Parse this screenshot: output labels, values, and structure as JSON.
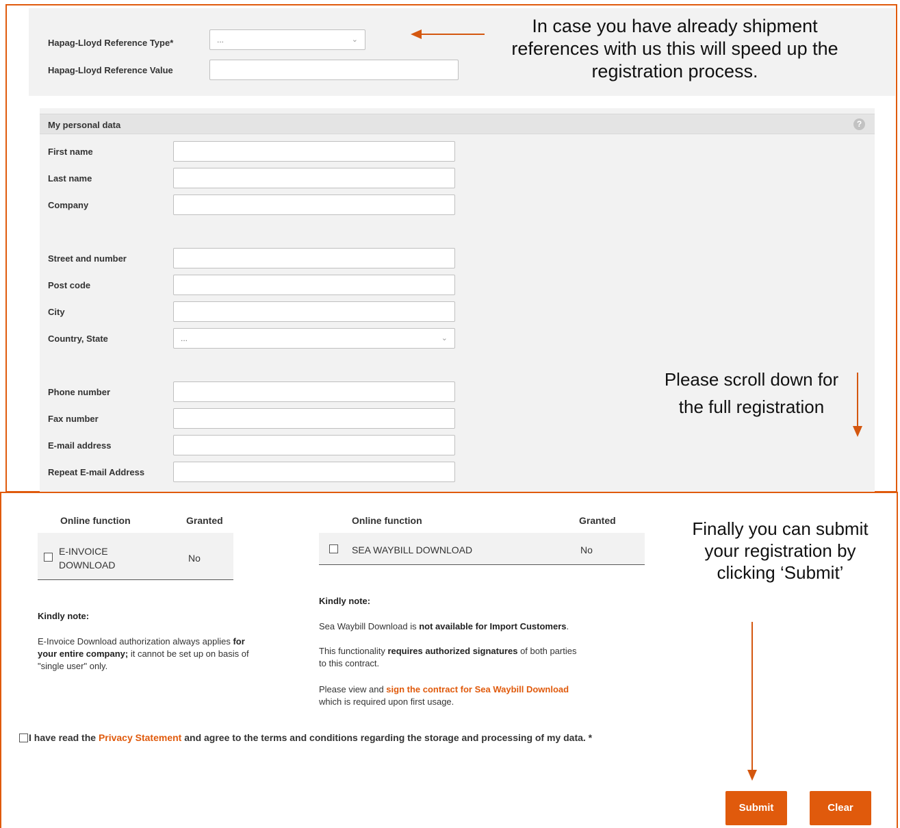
{
  "reference": {
    "type_label": "Hapag-Lloyd Reference Type*",
    "type_value": "...",
    "value_label": "Hapag-Lloyd Reference Value",
    "value": ""
  },
  "callouts": {
    "reference_note": "In case you have already shipment references with us this will speed up the registration process.",
    "scroll_note_line1": "Please scroll down for",
    "scroll_note_line2": "the full registration",
    "submit_note": "Finally you can submit your registration by clicking ‘Submit’"
  },
  "personal": {
    "title": "My personal data",
    "help_icon": "?",
    "fields": {
      "first_name": "First name",
      "last_name": "Last name",
      "company": "Company",
      "street": "Street and number",
      "post_code": "Post code",
      "city": "City",
      "country": "Country, State",
      "country_value": "...",
      "phone": "Phone number",
      "fax": "Fax number",
      "email": "E-mail address",
      "repeat_email": "Repeat E-mail Address"
    }
  },
  "functions_left": {
    "header_function": "Online function",
    "header_granted": "Granted",
    "row_name_line1": "E-INVOICE",
    "row_name_line2": "DOWNLOAD",
    "row_granted": "No",
    "kindly": "Kindly note:",
    "note_1": "E-Invoice Download authorization always applies",
    "note_bold_1": "for",
    "note_bold_2": "your entire company;",
    "note_2": "it cannot be set up on basis of",
    "note_3": "\"single user\" only."
  },
  "functions_right": {
    "header_function": "Online function",
    "header_granted": "Granted",
    "row_name": "SEA WAYBILL DOWNLOAD",
    "row_granted": "No",
    "kindly": "Kindly note:",
    "p1_text": "Sea Waybill Download is",
    "p1_bold": "not available for Import Customers",
    "p1_end": ".",
    "p2_text": "This functionality",
    "p2_bold": "requires authorized signatures",
    "p2_end": "of both parties",
    "p2_line2": "to this contract.",
    "p3_text": "Please view and",
    "p3_link": "sign the contract for Sea Waybill Download",
    "p3_line2": "which is required upon first usage."
  },
  "privacy": {
    "text_before": "I have read the",
    "link": "Privacy Statement",
    "text_after": "and agree to the terms and conditions regarding the storage and processing of my data. *"
  },
  "buttons": {
    "submit": "Submit",
    "clear": "Clear"
  },
  "colors": {
    "accent": "#e05a0c",
    "panel": "#f2f2f2"
  }
}
